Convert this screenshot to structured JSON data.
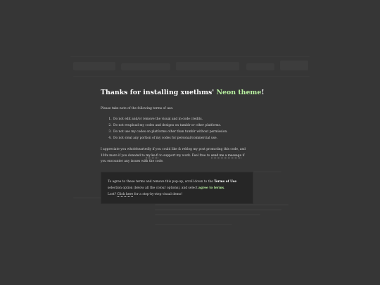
{
  "popup": {
    "title_prefix": "Thanks for installing xuethms' ",
    "title_accent": "Neon theme",
    "title_suffix": "!",
    "intro": "Please take note of the following terms of use:",
    "terms": [
      "Do not edit and/or remove the visual and in-code credits.",
      "Do not reupload my codes and designs on tumblr or other platforms.",
      "Do not use my codes on platforms other than tumblr without permission.",
      "Do not steal any portion of my codes for personal/commercial use."
    ],
    "appreciate": {
      "part1": "I appreciate you wholeheartedly if you could like & reblog my post promoting this code, and 100x more if you donated to ",
      "kofi_link": "my ko-fi",
      "part2": " to support my work. Feel free to ",
      "message_link": "send me a message",
      "part3": " if you encounter any issues with the code."
    },
    "notice": {
      "part1": "To agree to these terms and remove this pop-up, scroll down to the ",
      "terms_bold": "Terms of Use",
      "part2": " selection option (below all the colour options), and select ",
      "agree_bold": "agree to terms",
      "part3": ".",
      "lost_prefix": "Lost? ",
      "click_link": "Click here",
      "lost_suffix": " for a step-by-step visual demo!"
    }
  },
  "colors": {
    "background": "#3b3b3b",
    "accent": "#b8f0a0",
    "notice_bg": "#262626"
  }
}
